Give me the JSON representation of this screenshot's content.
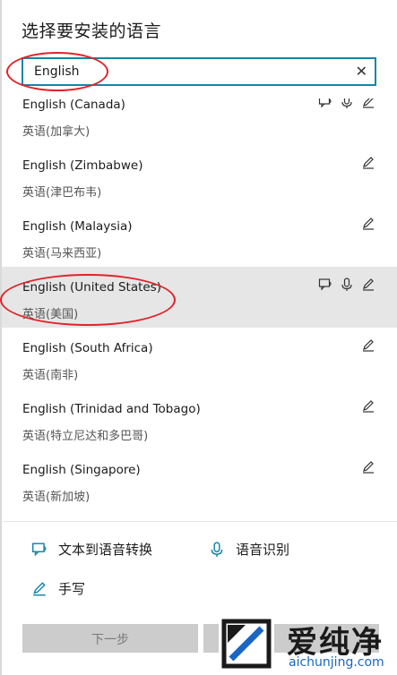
{
  "header": {
    "title": "选择要安装的语言"
  },
  "search": {
    "value": "English",
    "clear_glyph": "✕"
  },
  "languages": [
    {
      "name": "English (Canada)",
      "native": "英语(加拿大)",
      "features": [
        "text-to-speech-icon",
        "speech-recognition-icon",
        "handwriting-icon"
      ]
    },
    {
      "name": "English (Zimbabwe)",
      "native": "英语(津巴布韦)",
      "features": [
        "handwriting-icon"
      ]
    },
    {
      "name": "English (Malaysia)",
      "native": "英语(马来西亚)",
      "features": [
        "handwriting-icon"
      ]
    },
    {
      "name": "English (United States)",
      "native": "英语(美国)",
      "features": [
        "text-to-speech-icon",
        "speech-recognition-icon",
        "handwriting-icon"
      ],
      "selected": true
    },
    {
      "name": "English (South Africa)",
      "native": "英语(南非)",
      "features": [
        "handwriting-icon"
      ]
    },
    {
      "name": "English (Trinidad and Tobago)",
      "native": "英语(特立尼达和多巴哥)",
      "features": [
        "handwriting-icon"
      ]
    },
    {
      "name": "English (Singapore)",
      "native": "英语(新加坡)",
      "features": [
        "handwriting-icon"
      ]
    }
  ],
  "legend": {
    "tts": "文本到语音转换",
    "speech": "语音识别",
    "handwriting": "手写"
  },
  "buttons": {
    "next": "下一步",
    "cancel": ""
  },
  "watermark": {
    "cn": "爱纯净",
    "en": "aichunjing.com"
  },
  "colors": {
    "accent": "#1585a8",
    "annotation": "#e0232a",
    "selected_bg": "#e6e6e6",
    "button_bg": "#cccccc"
  }
}
